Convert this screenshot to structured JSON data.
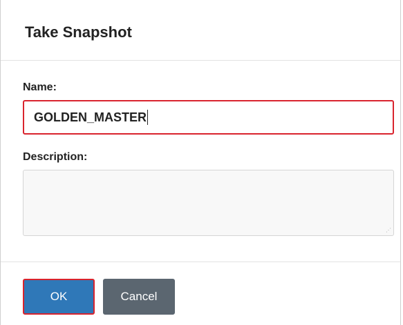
{
  "dialog": {
    "title": "Take Snapshot"
  },
  "form": {
    "name_label": "Name:",
    "name_value": "GOLDEN_MASTER",
    "description_label": "Description:",
    "description_value": ""
  },
  "footer": {
    "ok_label": "OK",
    "cancel_label": "Cancel"
  },
  "colors": {
    "primary": "#2f78b8",
    "secondary": "#5b6670",
    "highlight": "#d9232d"
  }
}
